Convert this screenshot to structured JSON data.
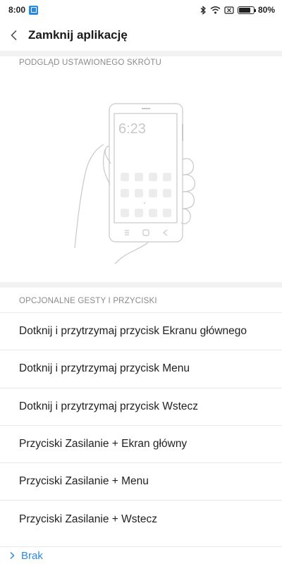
{
  "status": {
    "time": "8:00",
    "battery": "80%",
    "battery_level": 0.8
  },
  "header": {
    "title": "Zamknij aplikację",
    "back_icon": "chevron-left-icon"
  },
  "preview_section": {
    "label": "PODGLĄD USTAWIONEGO SKRÓTU",
    "phone_clock": "6:23"
  },
  "options_section": {
    "label": "OPCJONALNE GESTY I PRZYCISKI",
    "items": [
      "Dotknij i przytrzymaj przycisk Ekranu głównego",
      "Dotknij i przytrzymaj przycisk Menu",
      "Dotknij i przytrzymaj przycisk Wstecz",
      "Przyciski Zasilanie + Ekran główny",
      "Przyciski Zasilanie + Menu",
      "Przyciski Zasilanie + Wstecz"
    ]
  },
  "bottom": {
    "label": "Brak",
    "accent": "#2b8ae2"
  }
}
